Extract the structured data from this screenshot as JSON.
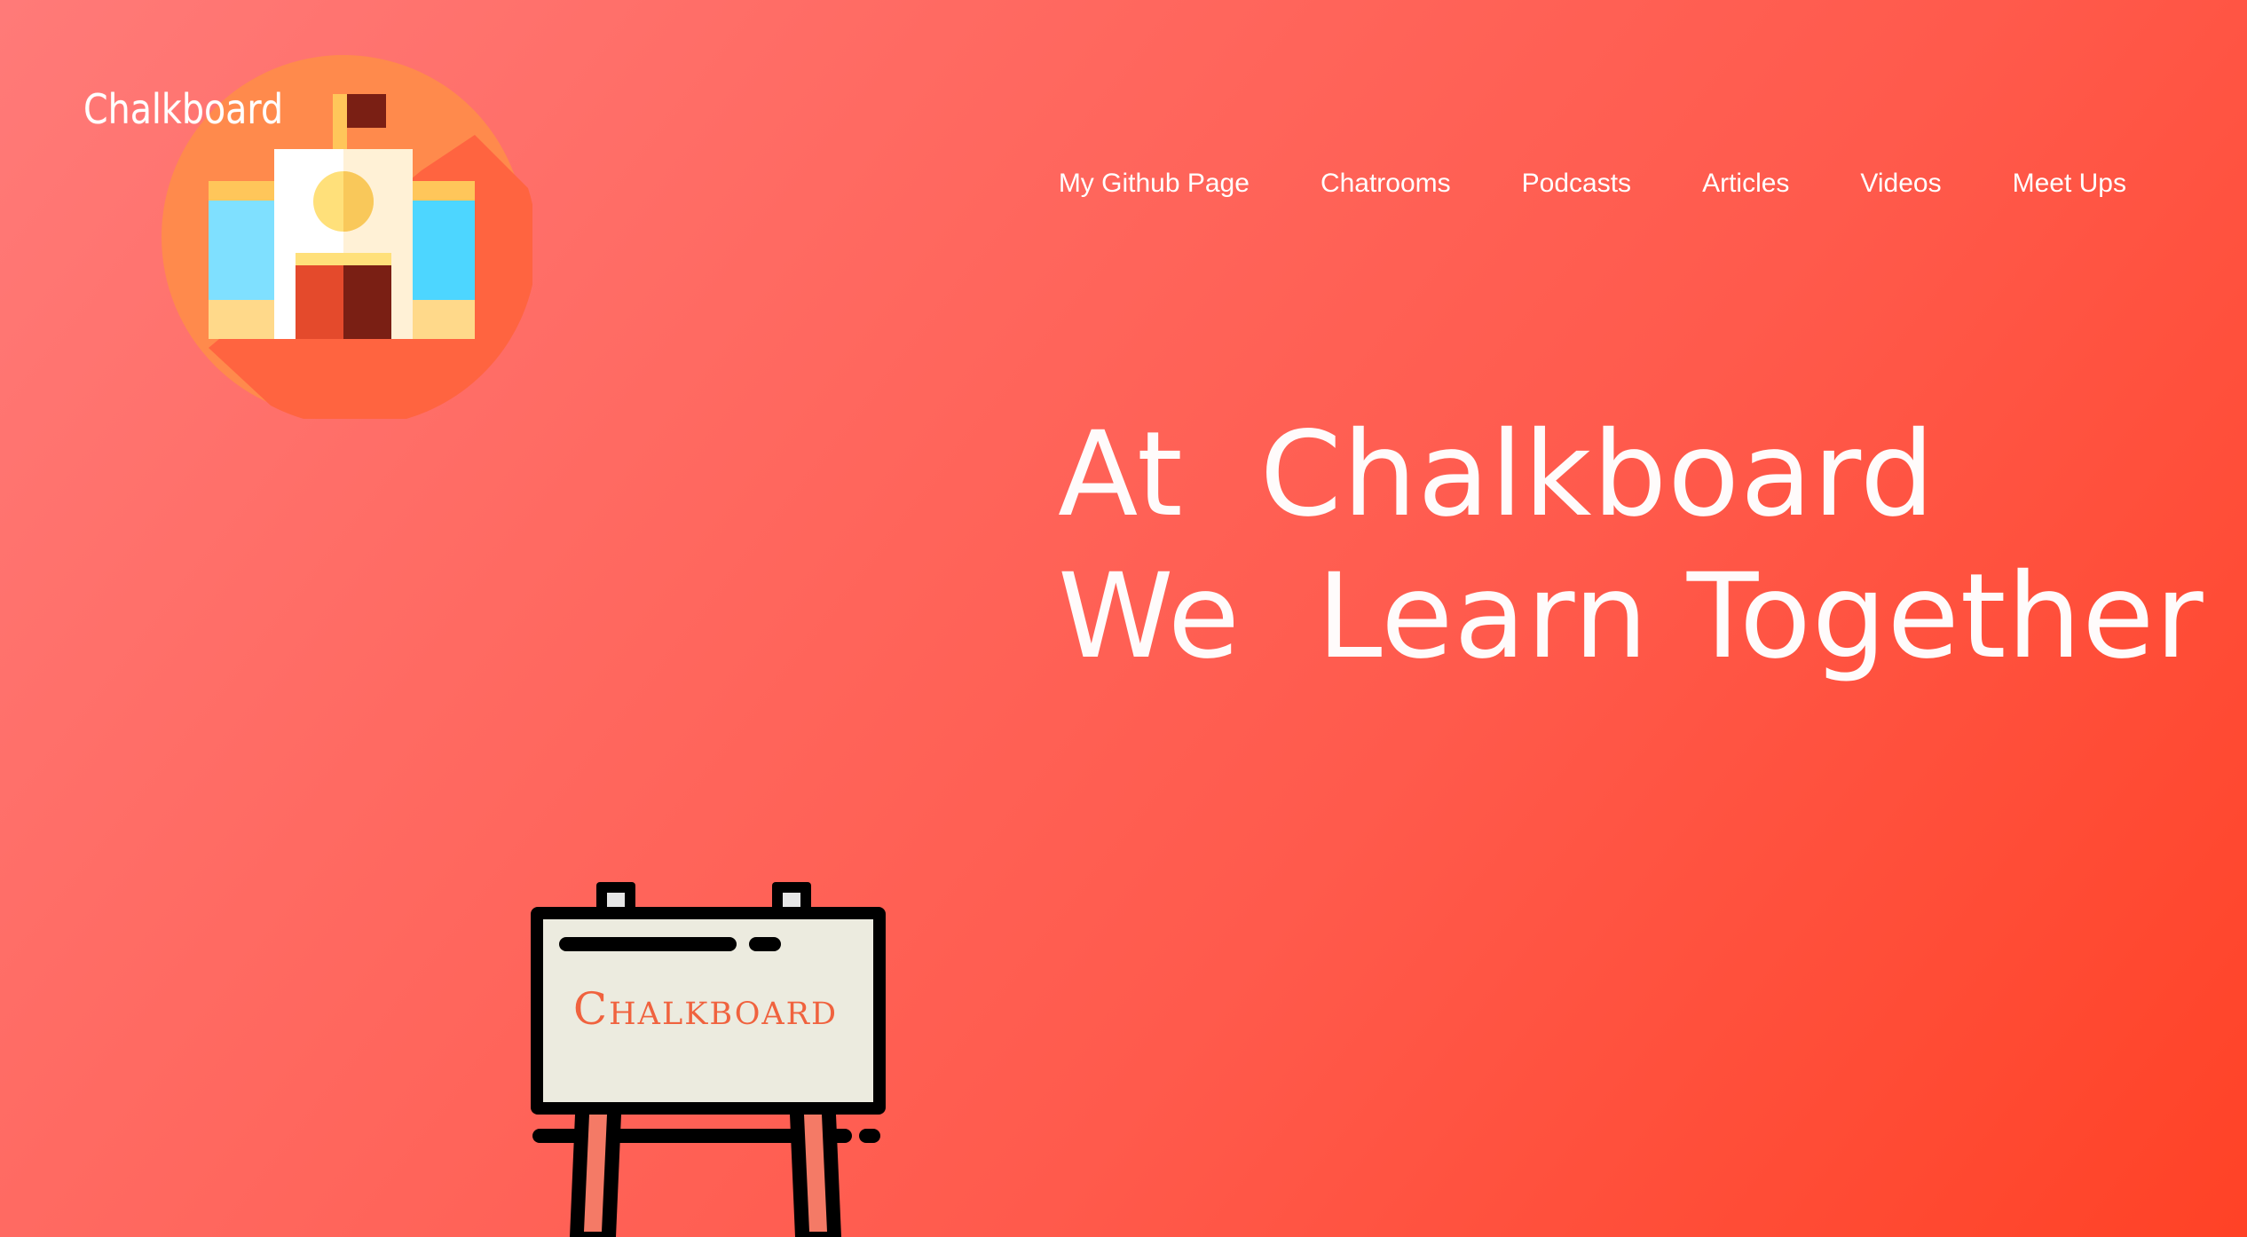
{
  "brand": {
    "name": "Chalkboard"
  },
  "nav": {
    "items": [
      {
        "label": "My Github Page"
      },
      {
        "label": "Chatrooms"
      },
      {
        "label": "Podcasts"
      },
      {
        "label": "Articles"
      },
      {
        "label": "Videos"
      },
      {
        "label": "Meet Ups"
      }
    ]
  },
  "hero": {
    "line1": "At  Chalkboard",
    "line2": "We  Learn Together"
  },
  "easel": {
    "sign_text": "Chalkboard"
  },
  "colors": {
    "background_start": "#ff7a78",
    "background_end": "#ff4226",
    "logo_circle": "#ff8a4c",
    "logo_shadow": "#ff6440",
    "sign_text": "#f0623e",
    "board": "#ecebdf"
  },
  "icons": {
    "logo": "school-building-icon",
    "easel": "easel-board-icon"
  }
}
